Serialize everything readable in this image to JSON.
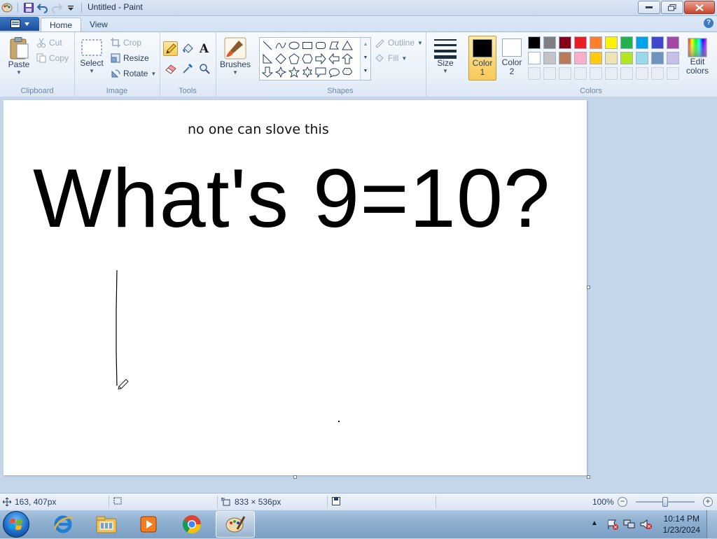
{
  "window": {
    "title": "Untitled - Paint"
  },
  "tabs": [
    {
      "label": "Home",
      "active": true
    },
    {
      "label": "View",
      "active": false
    }
  ],
  "ribbon": {
    "clipboard": {
      "group_label": "Clipboard",
      "paste": "Paste",
      "cut": "Cut",
      "copy": "Copy"
    },
    "image": {
      "group_label": "Image",
      "select": "Select",
      "crop": "Crop",
      "resize": "Resize",
      "rotate": "Rotate"
    },
    "tools": {
      "group_label": "Tools",
      "items": [
        "pencil-icon",
        "fill-bucket-icon",
        "text-icon",
        "eraser-icon",
        "color-picker-icon",
        "magnifier-icon"
      ],
      "text_glyph": "A"
    },
    "brushes": {
      "label": "Brushes"
    },
    "shapes": {
      "group_label": "Shapes",
      "outline": "Outline",
      "fill": "Fill"
    },
    "size": {
      "label": "Size"
    },
    "colors": {
      "group_label": "Colors",
      "color1_label": "Color",
      "color1_num": "1",
      "color2_label": "Color",
      "color2_num": "2",
      "edit_colors": "Edit",
      "edit_colors2": "colors",
      "color1": "#000000",
      "color2": "#ffffff",
      "palette_row1": [
        "#000000",
        "#7f7f7f",
        "#880015",
        "#ed1c24",
        "#ff7f27",
        "#fff200",
        "#22b14c",
        "#00a2e8",
        "#3f48cc",
        "#a349a4"
      ],
      "palette_row2": [
        "#ffffff",
        "#c3c3c3",
        "#b97a57",
        "#ffaec9",
        "#ffc90e",
        "#efe4b0",
        "#b5e61d",
        "#99d9ea",
        "#7092be",
        "#c8bfe7"
      ]
    }
  },
  "canvas": {
    "subtitle": "no one can slove this",
    "headline": "What's 9=10?"
  },
  "statusbar": {
    "cursor_pos": "163, 407px",
    "canvas_size": "833 × 536px",
    "zoom": "100%",
    "zoom_level_percent": 100
  },
  "taskbar": {
    "apps": [
      "internet-explorer-icon",
      "file-explorer-icon",
      "media-player-icon",
      "chrome-icon",
      "paint-icon"
    ],
    "time": "10:14 PM",
    "date": "1/23/2024"
  }
}
